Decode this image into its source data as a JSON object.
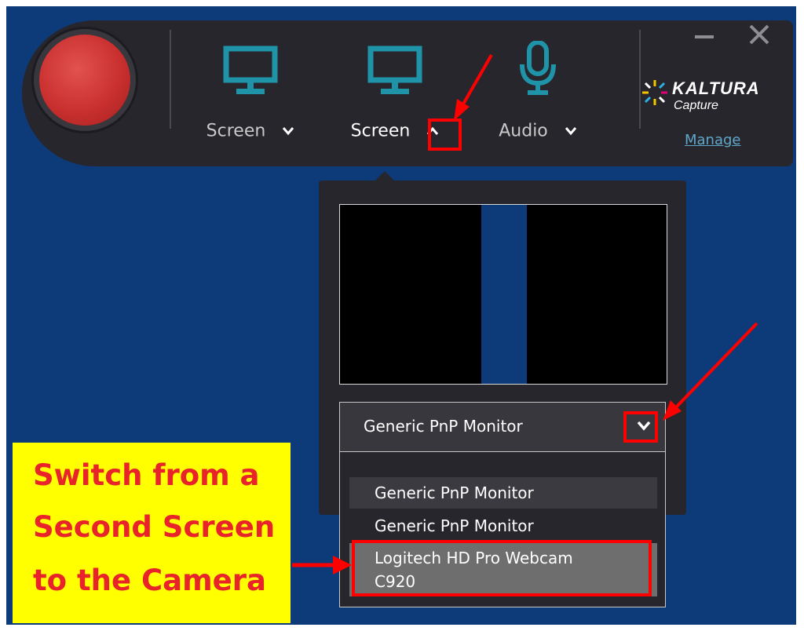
{
  "toolbar": {
    "tools": [
      {
        "label": "Screen",
        "chevron": "down"
      },
      {
        "label": "Screen",
        "chevron": "up"
      },
      {
        "label": "Audio",
        "chevron": "down"
      }
    ],
    "brand": {
      "name": "KALTURA",
      "sub": "Capture"
    },
    "manage_label": "Manage"
  },
  "popup": {
    "select": {
      "value": "Generic PnP Monitor"
    },
    "options": [
      {
        "label": "Generic PnP Monitor"
      },
      {
        "label": "Generic PnP Monitor"
      },
      {
        "label_line1": "Logitech HD Pro Webcam",
        "label_line2": "C920"
      }
    ]
  },
  "callout": {
    "line1": "Switch from a",
    "line2": "Second Screen",
    "line3": "to the Camera"
  },
  "colors": {
    "background": "#0d3a78",
    "toolbar": "#27262c",
    "accent_teal": "#1f94a8",
    "record_red": "#c9302f",
    "annotation_red": "#ff0000",
    "callout_yellow": "#ffff00",
    "callout_text": "#e8232a"
  },
  "icons": [
    "monitor-icon",
    "microphone-icon",
    "chevron-down-icon",
    "chevron-up-icon",
    "minimize-icon",
    "close-icon",
    "kaltura-logo-icon"
  ]
}
